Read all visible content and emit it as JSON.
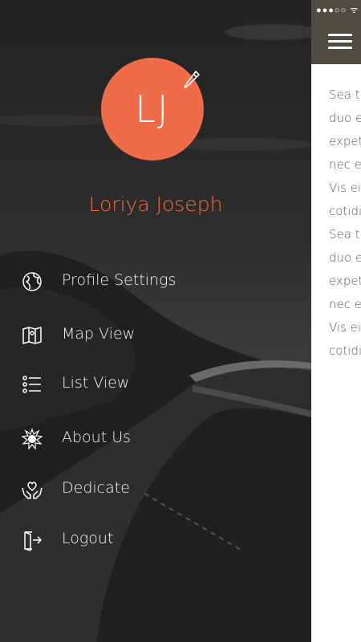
{
  "status_bar": {
    "signal": "●●●○○",
    "wifi": "ᯤ"
  },
  "content": {
    "paragraph_lines": [
      "Sea to",
      "duo e",
      "expete",
      "nec ei",
      " Vis ei",
      "cotidie",
      "Sea to",
      "duo e",
      "expete",
      "nec ei",
      " Vis ei",
      "cotidie"
    ]
  },
  "profile": {
    "initials": "LJ",
    "name": "Loriya Joseph",
    "avatar_color": "#ef6c48"
  },
  "menu": {
    "items": [
      {
        "label": "Profile Settings",
        "icon": "globe-icon"
      },
      {
        "label": "Map View",
        "icon": "map-icon"
      },
      {
        "label": "List View",
        "icon": "list-icon"
      },
      {
        "label": "About Us",
        "icon": "badge-icon"
      },
      {
        "label": "Dedicate",
        "icon": "hands-heart-icon"
      },
      {
        "label": "Logout",
        "icon": "logout-icon"
      }
    ]
  },
  "colors": {
    "accent": "#ef6c48",
    "header": "#4e4c41",
    "drawer": "#2d2d2d"
  }
}
